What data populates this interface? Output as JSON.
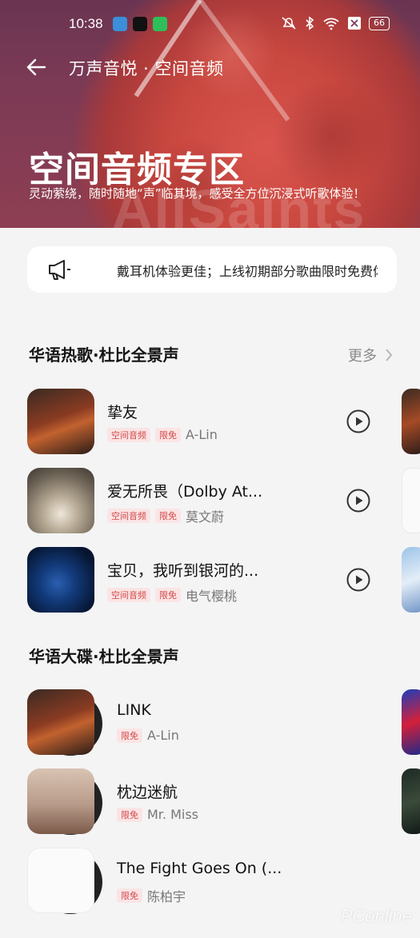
{
  "status": {
    "time": "10:38",
    "battery": "66",
    "colors": {
      "icon1": "#3a8fd8",
      "icon2": "#111111",
      "icon3": "#2fbf5a"
    }
  },
  "header": {
    "title": "万声音悦 · 空间音频"
  },
  "hero": {
    "title": "空间音频专区",
    "subtitle": "灵动萦绕，随时随地“声”临其境，感受全方位沉浸式听歌体验！",
    "watermark": "AllSaints"
  },
  "notice": {
    "text": "戴耳机体验更佳；上线初期部分歌曲限时免费体"
  },
  "sections": [
    {
      "title": "华语热歌·杜比全景声",
      "more": "更多",
      "items": [
        {
          "title": "挚友",
          "tags": [
            "空间音频",
            "限免"
          ],
          "artist": "A-Lin"
        },
        {
          "title": "爱无所畏（Dolby At...",
          "tags": [
            "空间音频",
            "限免"
          ],
          "artist": "莫文蔚"
        },
        {
          "title": "宝贝，我听到银河的...",
          "tags": [
            "空间音频",
            "限免"
          ],
          "artist": "电气樱桃"
        }
      ]
    },
    {
      "title": "华语大碟·杜比全景声",
      "items": [
        {
          "title": "LINK",
          "tags": [
            "限免"
          ],
          "artist": "A-Lin"
        },
        {
          "title": "枕边迷航",
          "tags": [
            "限免"
          ],
          "artist": "Mr. Miss"
        },
        {
          "title": "The Fight Goes On (...",
          "tags": [
            "限免"
          ],
          "artist": "陈柏宇"
        }
      ]
    }
  ],
  "credit": "PConline",
  "colors": {
    "tag_text": "#d2494b",
    "tag_bg": "#fbe4e4",
    "banner": "#8e3e52"
  }
}
